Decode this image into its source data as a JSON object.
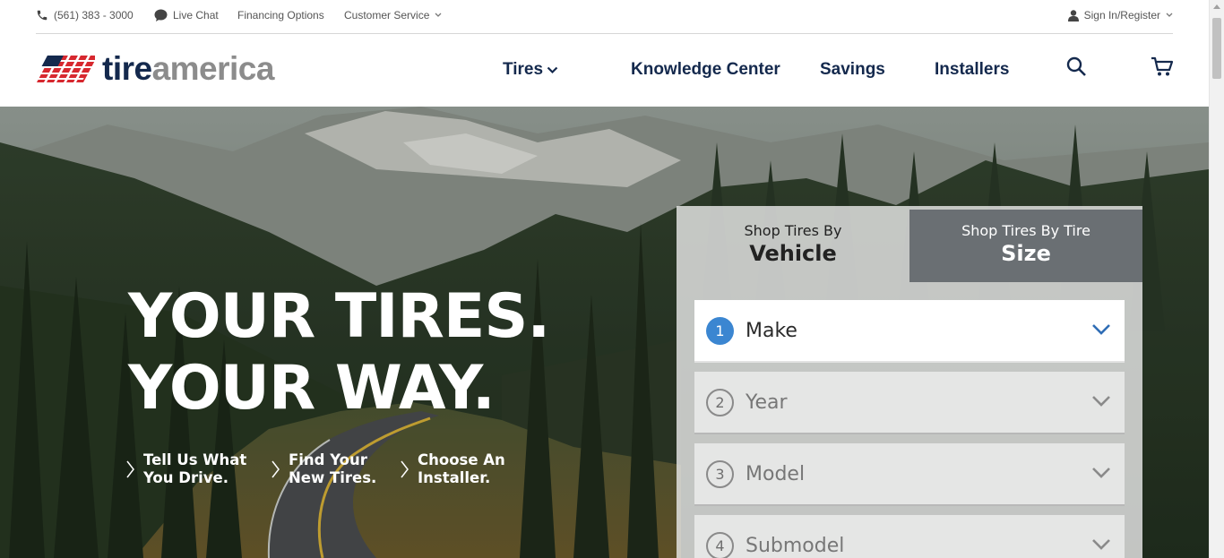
{
  "utility": {
    "phone": "(561) 383 - 3000",
    "live_chat": "Live Chat",
    "financing": "Financing Options",
    "customer_service": "Customer Service",
    "sign_in": "Sign In/Register"
  },
  "logo": {
    "part1": "tire",
    "part2": "america"
  },
  "nav": {
    "tires": "Tires",
    "knowledge_center": "Knowledge Center",
    "savings": "Savings",
    "installers": "Installers"
  },
  "icons": {
    "phone": "phone-icon",
    "chat": "chat-bubble-icon",
    "user": "user-icon",
    "search": "search-icon",
    "cart": "cart-icon",
    "chevron": "chevron-down-icon",
    "step": "chevron-right-icon"
  },
  "hero": {
    "headline_line1": "YOUR TIRES.",
    "headline_line2": "YOUR WAY.",
    "steps": [
      {
        "line1": "Tell Us What",
        "line2": "You Drive."
      },
      {
        "line1": "Find Your",
        "line2": "New Tires."
      },
      {
        "line1": "Choose An",
        "line2": "Installer."
      }
    ]
  },
  "shop": {
    "tabs": [
      {
        "sub": "Shop Tires By",
        "main": "Vehicle",
        "active": true
      },
      {
        "sub": "Shop Tires By Tire",
        "main": "Size",
        "active": false
      }
    ],
    "fields": [
      {
        "number": "1",
        "label": "Make",
        "active": true
      },
      {
        "number": "2",
        "label": "Year",
        "active": false
      },
      {
        "number": "3",
        "label": "Model",
        "active": false
      },
      {
        "number": "4",
        "label": "Submodel",
        "active": false
      }
    ]
  },
  "colors": {
    "navy": "#14294d",
    "logo_gray": "#8c8c8c",
    "logo_red": "#d7282f",
    "step_blue": "#3b86d1",
    "tab_inactive": "#6a6f73"
  }
}
